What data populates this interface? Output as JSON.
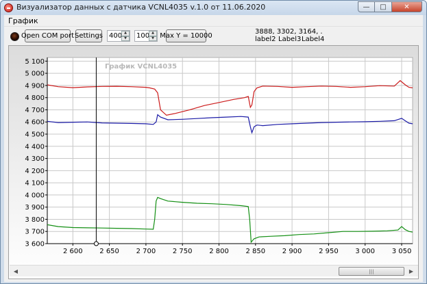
{
  "window": {
    "title": "Визуализатор данных с датчика VCNL4035 v.1.0 от 11.06.2020",
    "min_glyph": "—",
    "max_glyph": "□",
    "close_glyph": "✕"
  },
  "menu": {
    "items": [
      "График"
    ]
  },
  "toolbar": {
    "open_port_label": "Open COM port",
    "settings_label": "Settings",
    "field1_value": "400",
    "field2_value": "100",
    "max_y_label": "Max Y = 10000",
    "readout_values": "3888, 3302, 3164, .",
    "label2": "label2",
    "label3": "Label3",
    "label4": "Label4",
    "spin_up": "▲",
    "spin_down": "▼"
  },
  "scrollbar": {
    "left_arrow": "◀",
    "right_arrow": "▶",
    "grip": "|||"
  },
  "colors": {
    "series_red": "#cc1a1a",
    "series_blue": "#1a1aa6",
    "series_green": "#138f13",
    "grid": "#c8c8c8",
    "cursor": "#000000"
  },
  "chart_data": {
    "type": "line",
    "title": "График VCNL4035",
    "xlim": [
      2565,
      3065
    ],
    "ylim": [
      3600,
      5130
    ],
    "x_ticks": [
      2600,
      2650,
      2700,
      2750,
      2800,
      2850,
      2900,
      2950,
      3000,
      3050
    ],
    "x_tick_labels": [
      "2 600",
      "2 650",
      "2 700",
      "2 750",
      "2 800",
      "2 850",
      "2 900",
      "2 950",
      "3 000",
      "3 050"
    ],
    "y_ticks": [
      3600,
      3700,
      3800,
      3900,
      4000,
      4100,
      4200,
      4300,
      4400,
      4500,
      4600,
      4700,
      4800,
      4900,
      5000,
      5100
    ],
    "y_tick_labels": [
      "3 600",
      "3 700",
      "3 800",
      "3 900",
      "4 000",
      "4 100",
      "4 200",
      "4 300",
      "4 400",
      "4 500",
      "4 600",
      "4 700",
      "4 800",
      "4 900",
      "5 000",
      "5 100"
    ],
    "grid": true,
    "cursor_x": 2632,
    "series": [
      {
        "color": "#cc1a1a",
        "x": [
          2565,
          2580,
          2600,
          2620,
          2640,
          2660,
          2680,
          2700,
          2705,
          2712,
          2716,
          2720,
          2728,
          2740,
          2760,
          2780,
          2800,
          2820,
          2835,
          2840,
          2843,
          2845,
          2848,
          2852,
          2860,
          2880,
          2900,
          2920,
          2940,
          2960,
          2980,
          3000,
          3020,
          3040,
          3048,
          3055,
          3060,
          3065
        ],
        "y": [
          4905,
          4890,
          4882,
          4888,
          4892,
          4893,
          4890,
          4885,
          4880,
          4870,
          4840,
          4700,
          4655,
          4670,
          4700,
          4735,
          4760,
          4785,
          4800,
          4810,
          4720,
          4740,
          4850,
          4880,
          4895,
          4892,
          4885,
          4890,
          4895,
          4892,
          4885,
          4890,
          4898,
          4895,
          4940,
          4905,
          4885,
          4880
        ]
      },
      {
        "color": "#1a1aa6",
        "x": [
          2565,
          2580,
          2600,
          2620,
          2640,
          2660,
          2680,
          2700,
          2710,
          2714,
          2716,
          2720,
          2730,
          2750,
          2770,
          2790,
          2810,
          2830,
          2840,
          2843,
          2845,
          2848,
          2852,
          2860,
          2880,
          2900,
          2920,
          2940,
          2960,
          2980,
          3000,
          3020,
          3040,
          3050,
          3056,
          3060,
          3065
        ],
        "y": [
          4605,
          4595,
          4598,
          4600,
          4592,
          4590,
          4588,
          4585,
          4580,
          4600,
          4660,
          4640,
          4618,
          4622,
          4628,
          4635,
          4640,
          4645,
          4640,
          4560,
          4512,
          4560,
          4575,
          4570,
          4580,
          4585,
          4590,
          4595,
          4598,
          4600,
          4602,
          4605,
          4610,
          4630,
          4605,
          4590,
          4585
        ]
      },
      {
        "color": "#138f13",
        "x": [
          2565,
          2580,
          2600,
          2620,
          2640,
          2660,
          2680,
          2700,
          2710,
          2712,
          2714,
          2716,
          2720,
          2730,
          2750,
          2770,
          2790,
          2810,
          2830,
          2840,
          2842,
          2844,
          2848,
          2855,
          2870,
          2890,
          2910,
          2930,
          2950,
          2970,
          2990,
          3010,
          3030,
          3045,
          3050,
          3055,
          3060,
          3065
        ],
        "y": [
          3755,
          3740,
          3732,
          3730,
          3728,
          3726,
          3724,
          3720,
          3718,
          3800,
          3950,
          3980,
          3970,
          3950,
          3940,
          3932,
          3928,
          3922,
          3912,
          3905,
          3800,
          3612,
          3640,
          3655,
          3660,
          3665,
          3675,
          3680,
          3690,
          3700,
          3700,
          3702,
          3705,
          3712,
          3740,
          3715,
          3700,
          3695
        ]
      }
    ]
  }
}
